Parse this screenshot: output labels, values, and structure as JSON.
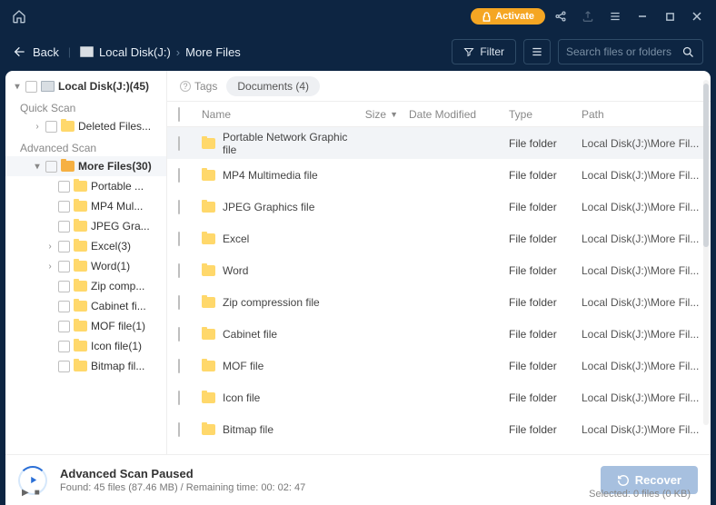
{
  "titlebar": {
    "activate": "Activate"
  },
  "toolbar": {
    "back": "Back",
    "bc1": "Local Disk(J:)",
    "bc2": "More Files",
    "filter": "Filter",
    "search_ph": "Search files or folders"
  },
  "sidebar": {
    "root": "Local Disk(J:)(45)",
    "quick": "Quick Scan",
    "del": "Deleted Files...",
    "adv": "Advanced Scan",
    "more": "More Files(30)",
    "children": [
      "Portable ...",
      "MP4 Mul...",
      "JPEG Gra...",
      "Excel(3)",
      "Word(1)",
      "Zip comp...",
      "Cabinet fi...",
      "MOF file(1)",
      "Icon file(1)",
      "Bitmap fil..."
    ]
  },
  "tagbar": {
    "tags": "Tags",
    "doc": "Documents (4)"
  },
  "columns": {
    "name": "Name",
    "size": "Size",
    "date": "Date Modified",
    "type": "Type",
    "path": "Path"
  },
  "rows": [
    {
      "name": "Portable Network Graphic file",
      "type": "File folder",
      "path": "Local Disk(J:)\\More Fil..."
    },
    {
      "name": "MP4 Multimedia file",
      "type": "File folder",
      "path": "Local Disk(J:)\\More Fil..."
    },
    {
      "name": "JPEG Graphics file",
      "type": "File folder",
      "path": "Local Disk(J:)\\More Fil..."
    },
    {
      "name": "Excel",
      "type": "File folder",
      "path": "Local Disk(J:)\\More Fil..."
    },
    {
      "name": "Word",
      "type": "File folder",
      "path": "Local Disk(J:)\\More Fil..."
    },
    {
      "name": "Zip compression file",
      "type": "File folder",
      "path": "Local Disk(J:)\\More Fil..."
    },
    {
      "name": "Cabinet file",
      "type": "File folder",
      "path": "Local Disk(J:)\\More Fil..."
    },
    {
      "name": "MOF file",
      "type": "File folder",
      "path": "Local Disk(J:)\\More Fil..."
    },
    {
      "name": "Icon file",
      "type": "File folder",
      "path": "Local Disk(J:)\\More Fil..."
    },
    {
      "name": "Bitmap file",
      "type": "File folder",
      "path": "Local Disk(J:)\\More Fil..."
    }
  ],
  "footer": {
    "title": "Advanced Scan Paused",
    "sub": "Found: 45 files (87.46 MB) / Remaining time: 00: 02: 47",
    "recover": "Recover",
    "selected": "Selected: 0 files (0 KB)"
  }
}
